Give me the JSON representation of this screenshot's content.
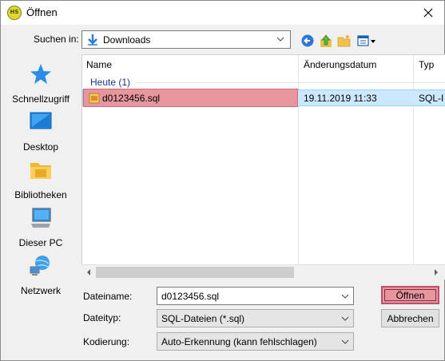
{
  "window": {
    "title": "Öffnen",
    "app_icon_text": "HS"
  },
  "toolbar": {
    "lookin_label": "Suchen in:",
    "lookin_value": "Downloads",
    "icons": [
      "back-icon",
      "up-folder-icon",
      "new-folder-icon",
      "view-menu-icon"
    ]
  },
  "places": [
    {
      "label": "Schnellzugriff",
      "icon": "star-icon"
    },
    {
      "label": "Desktop",
      "icon": "desktop-icon"
    },
    {
      "label": "Bibliotheken",
      "icon": "library-icon"
    },
    {
      "label": "Dieser PC",
      "icon": "pc-icon"
    },
    {
      "label": "Netzwerk",
      "icon": "network-icon"
    }
  ],
  "filelist": {
    "columns": [
      "Name",
      "Änderungsdatum",
      "Typ"
    ],
    "group": "Heute (1)",
    "rows": [
      {
        "name": "d0123456.sql",
        "date": "19.11.2019 11:33",
        "type": "SQL-I"
      }
    ]
  },
  "fields": {
    "filename_label": "Dateiname:",
    "filename_value": "d0123456.sql",
    "filetype_label": "Dateityp:",
    "filetype_value": "SQL-Dateien (*.sql)",
    "encoding_label": "Kodierung:",
    "encoding_value": "Auto-Erkennung (kann fehlschlagen)"
  },
  "buttons": {
    "open": "Öffnen",
    "cancel": "Abbrechen"
  },
  "colors": {
    "highlight": "#e8969e",
    "selection": "#cce8ff",
    "group_text": "#1e3287"
  }
}
